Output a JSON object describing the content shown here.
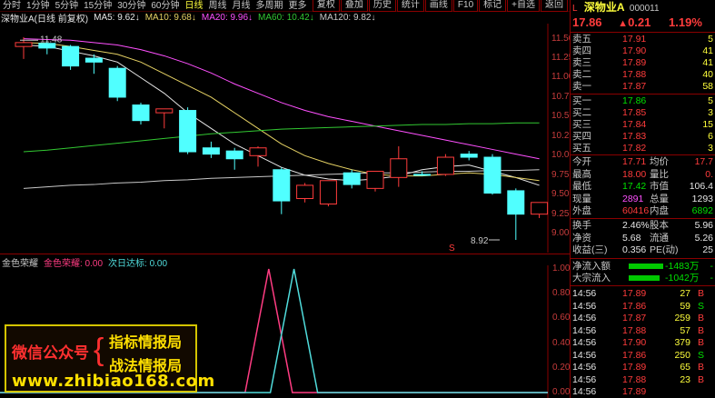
{
  "toolbar": {
    "periods": [
      "分时",
      "1分钟",
      "5分钟",
      "15分钟",
      "30分钟",
      "60分钟",
      "日线",
      "周线",
      "月线",
      "多周期",
      "更多"
    ],
    "active_period": "日线",
    "buttons": [
      "复权",
      "叠加",
      "历史",
      "统计",
      "画线",
      "F10",
      "标记",
      "+自选",
      "返回"
    ]
  },
  "stock_title": "深物业A(日线 前复权)",
  "ma": [
    {
      "label": "MA5: 9.62",
      "color": "#e6e6e6"
    },
    {
      "label": "MA10: 9.68",
      "color": "#e6d264"
    },
    {
      "label": "MA20: 9.96",
      "color": "#ff50ff"
    },
    {
      "label": "MA60: 10.42",
      "color": "#32c832"
    },
    {
      "label": "MA120: 9.82",
      "color": "#c8c8c8"
    }
  ],
  "axis": {
    "main_ticks": [
      "11.50",
      "11.25",
      "11.00",
      "10.75",
      "10.50",
      "10.25",
      "10.00",
      "9.75",
      "9.50",
      "9.25",
      "9.00"
    ],
    "sub_ticks": [
      "1.00",
      "0.80",
      "0.60",
      "0.40",
      "0.20",
      "0.00"
    ]
  },
  "annotations": {
    "high": "11.48",
    "low": "8.92",
    "marker": "S"
  },
  "subchart": {
    "name": "金色荣耀",
    "line1": "金色荣耀: 0.00",
    "line2": "次日达标: 0.00",
    "peaks": [
      {
        "series": "金色荣耀",
        "peak_index": 11,
        "value": 1.0
      },
      {
        "series": "次日达标",
        "peak_index": 12,
        "value": 1.0
      }
    ]
  },
  "chart_data": {
    "type": "candlestick",
    "ylim": [
      8.85,
      11.6
    ],
    "candles": [
      {
        "o": 11.4,
        "h": 11.52,
        "l": 11.24,
        "c": 11.45
      },
      {
        "o": 11.44,
        "h": 11.48,
        "l": 11.3,
        "c": 11.38
      },
      {
        "o": 11.4,
        "h": 11.42,
        "l": 11.1,
        "c": 11.15
      },
      {
        "o": 11.25,
        "h": 11.3,
        "l": 11.05,
        "c": 11.2
      },
      {
        "o": 11.12,
        "h": 11.15,
        "l": 10.7,
        "c": 10.75
      },
      {
        "o": 10.65,
        "h": 10.68,
        "l": 10.4,
        "c": 10.45
      },
      {
        "o": 10.55,
        "h": 10.6,
        "l": 10.35,
        "c": 10.6
      },
      {
        "o": 10.58,
        "h": 10.62,
        "l": 10.02,
        "c": 10.05
      },
      {
        "o": 10.1,
        "h": 10.18,
        "l": 9.97,
        "c": 10.02
      },
      {
        "o": 10.06,
        "h": 10.1,
        "l": 9.82,
        "c": 9.96
      },
      {
        "o": 10.0,
        "h": 10.12,
        "l": 9.86,
        "c": 10.1
      },
      {
        "o": 9.82,
        "h": 9.85,
        "l": 9.25,
        "c": 9.42
      },
      {
        "o": 9.45,
        "h": 9.65,
        "l": 9.4,
        "c": 9.62
      },
      {
        "o": 9.38,
        "h": 9.68,
        "l": 9.35,
        "c": 9.68
      },
      {
        "o": 9.78,
        "h": 9.82,
        "l": 9.58,
        "c": 9.63
      },
      {
        "o": 9.58,
        "h": 9.8,
        "l": 9.54,
        "c": 9.8
      },
      {
        "o": 9.72,
        "h": 10.12,
        "l": 9.6,
        "c": 9.96
      },
      {
        "o": 9.76,
        "h": 9.8,
        "l": 9.74,
        "c": 9.75
      },
      {
        "o": 9.76,
        "h": 10.02,
        "l": 9.74,
        "c": 9.98
      },
      {
        "o": 10.02,
        "h": 10.06,
        "l": 9.94,
        "c": 9.98
      },
      {
        "o": 9.98,
        "h": 10.02,
        "l": 9.5,
        "c": 9.52
      },
      {
        "o": 9.55,
        "h": 9.58,
        "l": 8.92,
        "c": 9.25
      },
      {
        "o": 9.25,
        "h": 9.4,
        "l": 9.2,
        "c": 9.4
      }
    ],
    "ma_series": [
      {
        "name": "MA5",
        "color": "#e6e6e6",
        "values": [
          11.42,
          11.4,
          11.34,
          11.28,
          11.2,
          11.0,
          10.8,
          10.55,
          10.35,
          10.15,
          10.0,
          9.85,
          9.75,
          9.7,
          9.68,
          9.7,
          9.74,
          9.82,
          9.86,
          9.88,
          9.8,
          9.72,
          9.62
        ]
      },
      {
        "name": "MA10",
        "color": "#e6d264",
        "values": [
          11.45,
          11.44,
          11.4,
          11.35,
          11.3,
          11.2,
          11.05,
          10.9,
          10.75,
          10.55,
          10.35,
          10.15,
          10.0,
          9.9,
          9.82,
          9.76,
          9.74,
          9.74,
          9.76,
          9.78,
          9.76,
          9.72,
          9.68
        ]
      },
      {
        "name": "MA20",
        "color": "#ff50ff",
        "values": [
          11.5,
          11.49,
          11.48,
          11.45,
          11.42,
          11.36,
          11.28,
          11.18,
          11.06,
          10.92,
          10.8,
          10.68,
          10.58,
          10.5,
          10.44,
          10.38,
          10.32,
          10.26,
          10.2,
          10.14,
          10.08,
          10.02,
          9.96
        ]
      },
      {
        "name": "MA60",
        "color": "#32c832",
        "values": [
          10.05,
          10.07,
          10.1,
          10.13,
          10.16,
          10.19,
          10.22,
          10.25,
          10.28,
          10.3,
          10.32,
          10.34,
          10.35,
          10.36,
          10.37,
          10.38,
          10.39,
          10.4,
          10.4,
          10.41,
          10.41,
          10.42,
          10.42
        ]
      },
      {
        "name": "MA120",
        "color": "#c8c8c8",
        "values": [
          9.58,
          9.6,
          9.62,
          9.63,
          9.65,
          9.66,
          9.68,
          9.69,
          9.71,
          9.72,
          9.73,
          9.74,
          9.75,
          9.76,
          9.77,
          9.78,
          9.78,
          9.79,
          9.8,
          9.8,
          9.81,
          9.81,
          9.82
        ]
      }
    ]
  },
  "quote": {
    "name": "深物业A",
    "code": "000011",
    "price": "17.86",
    "change": "0.21",
    "pct": "1.19",
    "asks": [
      {
        "label": "卖五",
        "price": "17.91",
        "vol": "5"
      },
      {
        "label": "卖四",
        "price": "17.90",
        "vol": "41"
      },
      {
        "label": "卖三",
        "price": "17.89",
        "vol": "41"
      },
      {
        "label": "卖二",
        "price": "17.88",
        "vol": "40"
      },
      {
        "label": "卖一",
        "price": "17.87",
        "vol": "58"
      }
    ],
    "bids": [
      {
        "label": "买一",
        "price": "17.86",
        "vol": "5"
      },
      {
        "label": "买二",
        "price": "17.85",
        "vol": "3"
      },
      {
        "label": "买三",
        "price": "17.84",
        "vol": "15"
      },
      {
        "label": "买四",
        "price": "17.83",
        "vol": "6"
      },
      {
        "label": "买五",
        "price": "17.82",
        "vol": "3"
      }
    ],
    "stats": [
      {
        "l1": "今开",
        "v1": "17.71",
        "c1": "red",
        "l2": "均价",
        "v2": "17.7",
        "c2": "red"
      },
      {
        "l1": "最高",
        "v1": "18.00",
        "c1": "red",
        "l2": "量比",
        "v2": "0.",
        "c2": "red"
      },
      {
        "l1": "最低",
        "v1": "17.42",
        "c1": "grn",
        "l2": "市值",
        "v2": "106.4",
        "c2": "wht"
      },
      {
        "l1": "现量",
        "v1": "2891",
        "c1": "mag",
        "l2": "总量",
        "v2": "1293",
        "c2": "wht"
      },
      {
        "l1": "外盘",
        "v1": "60416",
        "c1": "red",
        "l2": "内盘",
        "v2": "6892",
        "c2": "grn"
      }
    ],
    "stats2": [
      {
        "l1": "换手",
        "v1": "2.46%",
        "l2": "股本",
        "v2": "5.96"
      },
      {
        "l1": "净资",
        "v1": "5.68",
        "l2": "流通",
        "v2": "5.26"
      },
      {
        "l1": "收益(三)",
        "v1": "0.356",
        "l2": "PE(动)",
        "v2": "25"
      }
    ],
    "flow": [
      {
        "label": "净流入额",
        "value": "-1483万",
        "tail": "-"
      },
      {
        "label": "大宗流入",
        "value": "-1042万",
        "tail": "-"
      }
    ],
    "ticks": [
      {
        "t": "14:56",
        "p": "17.89",
        "v": "27",
        "s": "B"
      },
      {
        "t": "14:56",
        "p": "17.86",
        "v": "59",
        "s": "S"
      },
      {
        "t": "14:56",
        "p": "17.87",
        "v": "259",
        "s": "B"
      },
      {
        "t": "14:56",
        "p": "17.88",
        "v": "57",
        "s": "B"
      },
      {
        "t": "14:56",
        "p": "17.90",
        "v": "379",
        "s": "B"
      },
      {
        "t": "14:56",
        "p": "17.86",
        "v": "250",
        "s": "S"
      },
      {
        "t": "14:56",
        "p": "17.89",
        "v": "65",
        "s": "B"
      },
      {
        "t": "14:56",
        "p": "17.88",
        "v": "23",
        "s": "B"
      },
      {
        "t": "14:56",
        "p": "17.89",
        "v": "",
        "s": ""
      }
    ]
  },
  "watermark": {
    "line1": "微信公众号",
    "line2": "指标情报局",
    "line3": "战法情报局",
    "url": "www.zhibiao168.com"
  }
}
